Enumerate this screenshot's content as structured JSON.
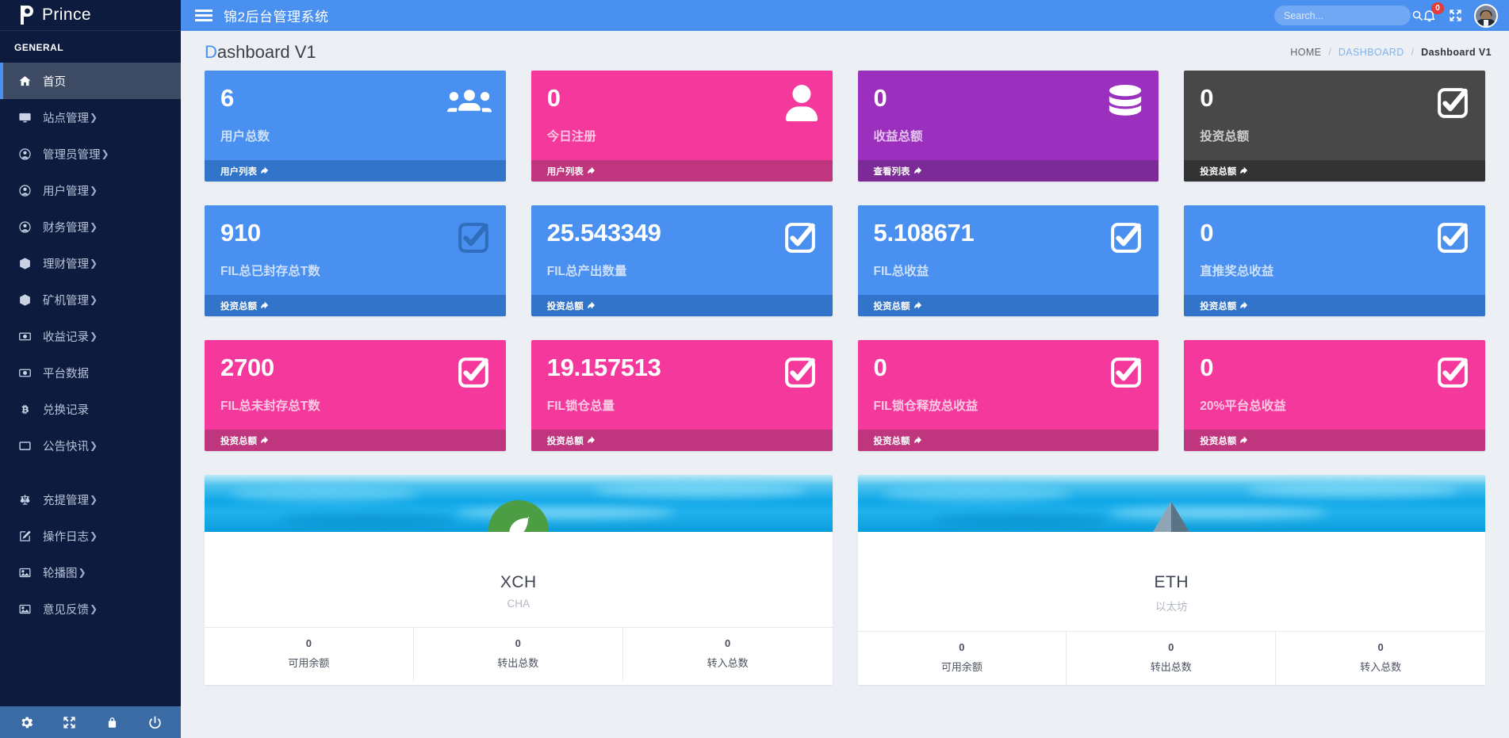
{
  "brand": {
    "name": "Prince"
  },
  "sidebar": {
    "section_label": "GENERAL",
    "items": [
      {
        "label": "首页",
        "icon": "home-icon",
        "caret": "",
        "active": true
      },
      {
        "label": "站点管理",
        "icon": "monitor-icon",
        "caret": "❯"
      },
      {
        "label": "管理员管理",
        "icon": "user-circle-icon",
        "caret": "❯"
      },
      {
        "label": "用户管理",
        "icon": "user-circle-icon",
        "caret": "❯"
      },
      {
        "label": "财务管理",
        "icon": "user-circle-icon",
        "caret": "❯"
      },
      {
        "label": "理财管理",
        "icon": "cube-icon",
        "caret": "❯"
      },
      {
        "label": "矿机管理",
        "icon": "cube-icon",
        "caret": "❯"
      },
      {
        "label": "收益记录",
        "icon": "money-icon",
        "caret": "❯"
      },
      {
        "label": "平台数据",
        "icon": "money-icon",
        "caret": ""
      },
      {
        "label": "兑换记录",
        "icon": "bitcoin-icon",
        "caret": ""
      },
      {
        "label": "公告快讯",
        "icon": "window-icon",
        "caret": "❯"
      },
      {
        "label": "充提管理",
        "icon": "balance-scale-icon",
        "caret": "❯"
      },
      {
        "label": "操作日志",
        "icon": "edit-icon",
        "caret": "❯"
      },
      {
        "label": "轮播图",
        "icon": "image-icon",
        "caret": "❯"
      },
      {
        "label": "意见反馈",
        "icon": "image-icon",
        "caret": "❯"
      }
    ],
    "footer_buttons": [
      {
        "name": "settings",
        "icon": "gear-icon"
      },
      {
        "name": "expand",
        "icon": "arrows-alt-icon"
      },
      {
        "name": "lock",
        "icon": "lock-icon"
      },
      {
        "name": "power",
        "icon": "power-icon"
      }
    ]
  },
  "topbar": {
    "menu_icon": "hamburger-icon",
    "title": "锦2后台管理系统",
    "search_placeholder": "Search...",
    "search_value": "",
    "search_icon": "search-icon",
    "bell_icon": "bell-icon",
    "bell_count": "0",
    "fullscreen_icon": "arrows-alt-icon",
    "avatar_icon": "avatar"
  },
  "page": {
    "title_first": "D",
    "title_rest": "ashboard V1",
    "breadcrumb": [
      {
        "label": "HOME",
        "style": "plain"
      },
      {
        "label": "DASHBOARD",
        "style": "link"
      },
      {
        "label": "Dashboard V1",
        "style": "current"
      }
    ],
    "breadcrumb_sep": "/"
  },
  "colors": {
    "blue": "#4a90f0",
    "blue_dark": "#3274c9",
    "pink": "#f5399c",
    "pink_dark": "#c0367e",
    "purple": "#9b2fbe",
    "purple_dark": "#7d2a99",
    "gray": "#484848",
    "gray_dark": "#333333",
    "accent": "#4a90f0"
  },
  "cards": [
    {
      "value": "6",
      "label": "用户总数",
      "link": "用户列表",
      "icon": "users-icon",
      "bg": "#4a90f0",
      "foot_bg": "#3274c9",
      "icon_color": "#ffffff"
    },
    {
      "value": "0",
      "label": "今日注册",
      "link": "用户列表",
      "icon": "user-icon",
      "bg": "#f5399c",
      "foot_bg": "#c0367e",
      "icon_color": "#ffffff"
    },
    {
      "value": "0",
      "label": "收益总额",
      "link": "查看列表",
      "icon": "database-icon",
      "bg": "#9b2fbe",
      "foot_bg": "#7d2a99",
      "icon_color": "#ffffff"
    },
    {
      "value": "0",
      "label": "投资总额",
      "link": "投资总额",
      "icon": "check-square-icon",
      "bg": "#484848",
      "foot_bg": "#333333",
      "icon_color": "#ffffff"
    },
    {
      "value": "910",
      "label": "FIL总已封存总T数",
      "link": "投资总额",
      "icon": "check-square-icon",
      "bg": "#4a90f0",
      "foot_bg": "#3274c9",
      "icon_color": "#2f6dbd"
    },
    {
      "value": "25.543349",
      "label": "FIL总产出数量",
      "link": "投资总额",
      "icon": "check-square-icon",
      "bg": "#4a90f0",
      "foot_bg": "#3274c9",
      "icon_color": "#ffffff"
    },
    {
      "value": "5.108671",
      "label": "FIL总收益",
      "link": "投资总额",
      "icon": "check-square-icon",
      "bg": "#4a90f0",
      "foot_bg": "#3274c9",
      "icon_color": "#ffffff"
    },
    {
      "value": "0",
      "label": "直推奖总收益",
      "link": "投资总额",
      "icon": "check-square-icon",
      "bg": "#4a90f0",
      "foot_bg": "#3274c9",
      "icon_color": "#ffffff"
    },
    {
      "value": "2700",
      "label": "FIL总未封存总T数",
      "link": "投资总额",
      "icon": "check-square-icon",
      "bg": "#f5399c",
      "foot_bg": "#c0367e",
      "icon_color": "#ffffff"
    },
    {
      "value": "19.157513",
      "label": "FIL锁仓总量",
      "link": "投资总额",
      "icon": "check-square-icon",
      "bg": "#f5399c",
      "foot_bg": "#c0367e",
      "icon_color": "#ffffff"
    },
    {
      "value": "0",
      "label": "FIL锁仓释放总收益",
      "link": "投资总额",
      "icon": "check-square-icon",
      "bg": "#f5399c",
      "foot_bg": "#c0367e",
      "icon_color": "#ffffff"
    },
    {
      "value": "0",
      "label": "20%平台总收益",
      "link": "投资总额",
      "icon": "check-square-icon",
      "bg": "#f5399c",
      "foot_bg": "#c0367e",
      "icon_color": "#ffffff"
    }
  ],
  "coins": [
    {
      "symbol": "XCH",
      "name": "CHA",
      "logo": "leaf-icon",
      "logo_color": "#4c9d43",
      "stats": [
        {
          "value": "0",
          "label": "可用余额"
        },
        {
          "value": "0",
          "label": "转出总数"
        },
        {
          "value": "0",
          "label": "转入总数"
        }
      ]
    },
    {
      "symbol": "ETH",
      "name": "以太坊",
      "logo": "ethereum-icon",
      "logo_color": "#7c93a6",
      "stats": [
        {
          "value": "0",
          "label": "可用余额"
        },
        {
          "value": "0",
          "label": "转出总数"
        },
        {
          "value": "0",
          "label": "转入总数"
        }
      ]
    }
  ]
}
